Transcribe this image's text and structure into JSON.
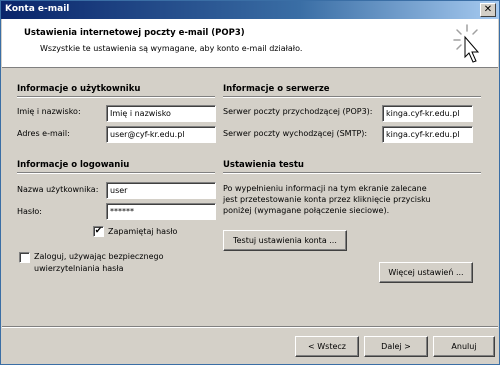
{
  "window": {
    "title": "Konta e-mail",
    "close_glyph": "✕"
  },
  "header": {
    "title": "Ustawienia internetowej poczty e-mail (POP3)",
    "subtitle": "Wszystkie te ustawienia są wymagane, aby konto e-mail działało."
  },
  "user_info": {
    "heading": "Informacje o użytkowniku",
    "name_label": "Imię i nazwisko:",
    "name_value": "Imię i nazwisko",
    "email_label": "Adres e-mail:",
    "email_value": "user@cyf-kr.edu.pl"
  },
  "server_info": {
    "heading": "Informacje o serwerze",
    "incoming_label": "Serwer poczty przychodzącej (POP3):",
    "incoming_value": "kinga.cyf-kr.edu.pl",
    "outgoing_label": "Serwer poczty wychodzącej (SMTP):",
    "outgoing_value": "kinga.cyf-kr.edu.pl"
  },
  "login_info": {
    "heading": "Informacje o logowaniu",
    "username_label": "Nazwa użytkownika:",
    "username_value": "user",
    "password_label": "Hasło:",
    "password_value": "******",
    "remember_label": "Zapamiętaj hasło",
    "remember_checked": "✔",
    "spa_label_line1": "Zaloguj, używając bezpiecznego",
    "spa_label_line2": "uwierzytelniania hasła"
  },
  "test_settings": {
    "heading": "Ustawienia testu",
    "description_line1": "Po wypełnieniu informacji na tym ekranie zalecane",
    "description_line2": "jest przetestowanie konta przez kliknięcie przycisku",
    "description_line3": "poniżej (wymagane połączenie sieciowe).",
    "test_button": "Testuj ustawienia konta ...",
    "more_button": "Więcej ustawień ..."
  },
  "footer": {
    "back_button": "< Wstecz",
    "next_button": "Dalej >",
    "cancel_button": "Anuluj"
  },
  "colors": {
    "title_bar": "#0a246a",
    "dialog_bg": "#d4d0c8"
  },
  "icons": {
    "wizard": "magic-wand-icon",
    "close": "close-icon"
  }
}
